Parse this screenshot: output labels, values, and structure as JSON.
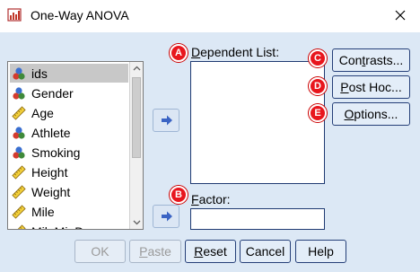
{
  "window": {
    "title": "One-Way ANOVA",
    "icon": "anova-dialog-icon",
    "close_icon": "close-icon"
  },
  "variables": [
    {
      "label": "ids",
      "icon": "nominal-icon",
      "selected": true
    },
    {
      "label": "Gender",
      "icon": "nominal-icon",
      "selected": false
    },
    {
      "label": "Age",
      "icon": "scale-ruler-icon",
      "selected": false
    },
    {
      "label": "Athlete",
      "icon": "nominal-icon",
      "selected": false
    },
    {
      "label": "Smoking",
      "icon": "nominal-icon",
      "selected": false
    },
    {
      "label": "Height",
      "icon": "scale-ruler-icon",
      "selected": false
    },
    {
      "label": "Weight",
      "icon": "scale-ruler-icon",
      "selected": false
    },
    {
      "label": "Mile",
      "icon": "scale-ruler-icon",
      "selected": false
    },
    {
      "label": "MileMinDur",
      "icon": "scale-ruler-icon",
      "selected": false
    }
  ],
  "dependent_list": {
    "label_pre": "",
    "label_mnemonic": "D",
    "label_post": "ependent List:",
    "badge": "A",
    "items": []
  },
  "factor": {
    "label_pre": "",
    "label_mnemonic": "F",
    "label_post": "actor:",
    "badge": "B",
    "value": ""
  },
  "side_buttons": {
    "contrasts": {
      "pre": "Con",
      "mnemonic": "t",
      "post": "rasts...",
      "badge": "C"
    },
    "post_hoc": {
      "pre": "",
      "mnemonic": "P",
      "post": "ost Hoc...",
      "badge": "D"
    },
    "options": {
      "pre": "",
      "mnemonic": "O",
      "post": "ptions...",
      "badge": "E"
    }
  },
  "bottom_buttons": {
    "ok": {
      "label": "OK",
      "enabled": false
    },
    "paste": {
      "pre": "",
      "mnemonic": "P",
      "post": "aste",
      "enabled": false
    },
    "reset": {
      "pre": "",
      "mnemonic": "R",
      "post": "eset",
      "enabled": true
    },
    "cancel": {
      "label": "Cancel",
      "enabled": true
    },
    "help": {
      "label": "Help",
      "enabled": true
    }
  },
  "colors": {
    "dialog_background": "#dce8f5",
    "badge_red": "#e8161d",
    "button_border": "#253f78"
  }
}
